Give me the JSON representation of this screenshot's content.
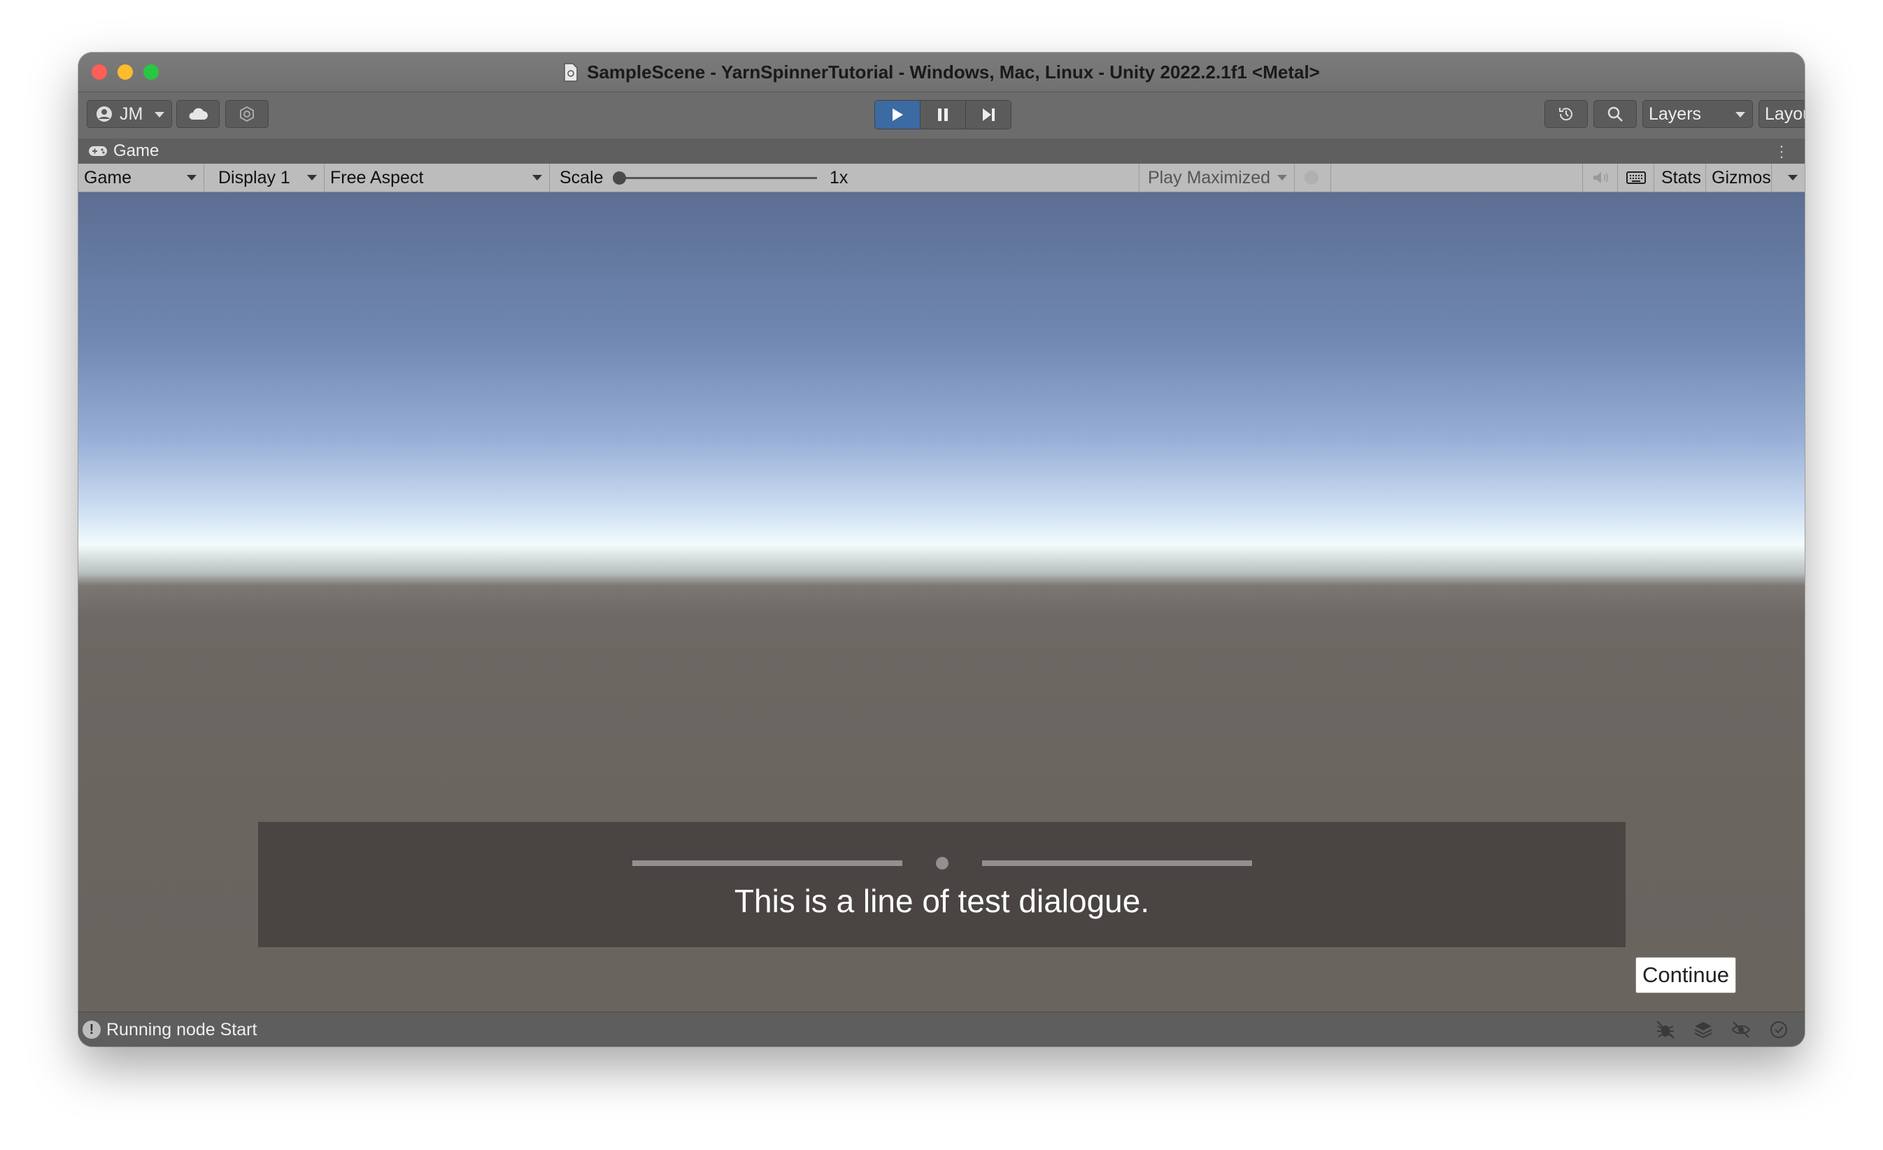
{
  "window": {
    "title": "SampleScene - YarnSpinnerTutorial - Windows, Mac, Linux - Unity 2022.2.1f1 <Metal>"
  },
  "toolbar": {
    "account_label": "JM",
    "layers_label": "Layers",
    "layout_label": "Layout",
    "play_state": "playing"
  },
  "panel": {
    "tab_label": "Game"
  },
  "game_toolbar": {
    "view_mode": "Game",
    "display": "Display 1",
    "aspect": "Free Aspect",
    "scale_label": "Scale",
    "scale_value": "1x",
    "play_mode": "Play Maximized",
    "stats_label": "Stats",
    "gizmos_label": "Gizmos"
  },
  "game": {
    "dialogue_text": "This is a line of test dialogue.",
    "continue_label": "Continue"
  },
  "status": {
    "message": "Running node Start"
  },
  "colors": {
    "play_active": "#3c6aa3",
    "dialogue_bg": "#4a4542",
    "sky_top": "#5c6e92",
    "ground": "#6a645f"
  },
  "icons": [
    "scene-file-icon",
    "account-icon",
    "cloud-icon",
    "collab-icon",
    "play-icon",
    "pause-icon",
    "step-icon",
    "history-icon",
    "search-icon",
    "gamepad-icon",
    "kebab-menu-icon",
    "mute-audio-icon",
    "keyboard-icon",
    "warning-icon",
    "bug-icon",
    "layers-stack-icon",
    "hidden-eye-icon",
    "check-circle-icon"
  ]
}
